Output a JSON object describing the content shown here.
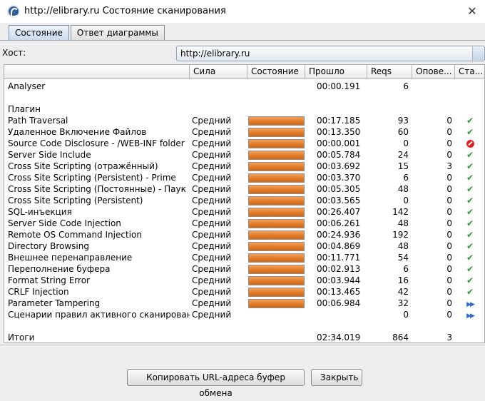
{
  "window": {
    "title": "http://elibrary.ru Состояние сканирования",
    "close_glyph": "✕"
  },
  "tabs": [
    {
      "label": "Состояние",
      "active": true
    },
    {
      "label": "Ответ диаграммы",
      "active": false
    }
  ],
  "host": {
    "label": "Хост:",
    "value": "http://elibrary.ru"
  },
  "columns": [
    "",
    "Сила",
    "Состояние",
    "Прошло",
    "Reqs",
    "Опове...",
    "Ста..."
  ],
  "analyser": {
    "name": "Analyser",
    "elapsed": "00:00.191",
    "reqs": "6"
  },
  "plugins_label": "Плагин",
  "plugins": [
    {
      "name": "Path Traversal",
      "strength": "Средний",
      "progress": 1,
      "elapsed": "00:17.185",
      "reqs": "93",
      "alerts": "0",
      "status": "ok"
    },
    {
      "name": "Удаленное Включение Файлов",
      "strength": "Средний",
      "progress": 1,
      "elapsed": "00:13.350",
      "reqs": "60",
      "alerts": "0",
      "status": "ok"
    },
    {
      "name": "Source Code Disclosure - /WEB-INF folder",
      "strength": "Средний",
      "progress": 1,
      "elapsed": "00:00.001",
      "reqs": "0",
      "alerts": "0",
      "status": "error"
    },
    {
      "name": "Server Side Include",
      "strength": "Средний",
      "progress": 1,
      "elapsed": "00:05.784",
      "reqs": "24",
      "alerts": "0",
      "status": "ok"
    },
    {
      "name": "Cross Site Scripting (отражённый)",
      "strength": "Средний",
      "progress": 1,
      "elapsed": "00:03.692",
      "reqs": "15",
      "alerts": "3",
      "status": "ok"
    },
    {
      "name": "Cross Site Scripting (Persistent) - Prime",
      "strength": "Средний",
      "progress": 1,
      "elapsed": "00:03.370",
      "reqs": "6",
      "alerts": "0",
      "status": "ok"
    },
    {
      "name": "Cross Site Scripting (Постоянные) - Паук",
      "strength": "Средний",
      "progress": 1,
      "elapsed": "00:05.305",
      "reqs": "48",
      "alerts": "0",
      "status": "ok"
    },
    {
      "name": "Cross Site Scripting (Persistent)",
      "strength": "Средний",
      "progress": 1,
      "elapsed": "00:03.565",
      "reqs": "0",
      "alerts": "0",
      "status": "ok"
    },
    {
      "name": "SQL-инъекция",
      "strength": "Средний",
      "progress": 1,
      "elapsed": "00:26.407",
      "reqs": "142",
      "alerts": "0",
      "status": "ok"
    },
    {
      "name": "Server Side Code Injection",
      "strength": "Средний",
      "progress": 1,
      "elapsed": "00:06.261",
      "reqs": "48",
      "alerts": "0",
      "status": "ok"
    },
    {
      "name": "Remote OS Command Injection",
      "strength": "Средний",
      "progress": 1,
      "elapsed": "00:24.936",
      "reqs": "192",
      "alerts": "0",
      "status": "ok"
    },
    {
      "name": "Directory Browsing",
      "strength": "Средний",
      "progress": 1,
      "elapsed": "00:04.869",
      "reqs": "48",
      "alerts": "0",
      "status": "ok"
    },
    {
      "name": "Внешнее перенаправление",
      "strength": "Средний",
      "progress": 1,
      "elapsed": "00:11.771",
      "reqs": "54",
      "alerts": "0",
      "status": "ok"
    },
    {
      "name": "Переполнение буфера",
      "strength": "Средний",
      "progress": 1,
      "elapsed": "00:02.913",
      "reqs": "6",
      "alerts": "0",
      "status": "ok"
    },
    {
      "name": "Format String Error",
      "strength": "Средний",
      "progress": 1,
      "elapsed": "00:03.944",
      "reqs": "16",
      "alerts": "0",
      "status": "ok"
    },
    {
      "name": "CRLF Injection",
      "strength": "Средний",
      "progress": 1,
      "elapsed": "00:13.465",
      "reqs": "42",
      "alerts": "0",
      "status": "ok"
    },
    {
      "name": "Parameter Tampering",
      "strength": "Средний",
      "progress": 1,
      "elapsed": "00:06.984",
      "reqs": "32",
      "alerts": "0",
      "status": "play"
    },
    {
      "name": "Сценарии правил активного сканирования",
      "strength": "Средний",
      "progress": null,
      "elapsed": "",
      "reqs": "0",
      "alerts": "0",
      "status": "play"
    }
  ],
  "totals": {
    "label": "Итоги",
    "elapsed": "02:34.019",
    "reqs": "864",
    "alerts": "3"
  },
  "buttons": {
    "copy": "Копировать URL-адреса буфер обмена",
    "close": "Закрыть"
  },
  "colors": {
    "progress": "#e07a25",
    "ok": "#2e9a2e",
    "error": "#e02020",
    "play": "#2b6fd0"
  }
}
